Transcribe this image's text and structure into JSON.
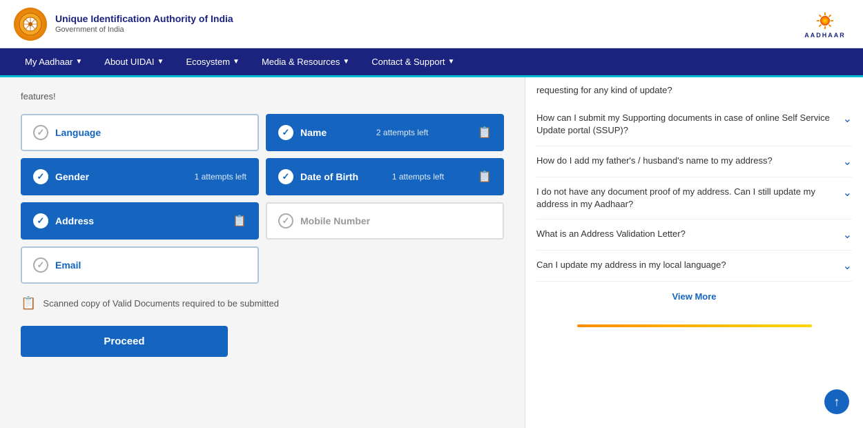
{
  "header": {
    "org_name": "Unique Identification Authority of India",
    "gov_name": "Government of India",
    "logo_text": "AADHAAR"
  },
  "navbar": {
    "items": [
      {
        "label": "My Aadhaar",
        "has_arrow": true
      },
      {
        "label": "About UIDAI",
        "has_arrow": true
      },
      {
        "label": "Ecosystem",
        "has_arrow": true
      },
      {
        "label": "Media & Resources",
        "has_arrow": true
      },
      {
        "label": "Contact & Support",
        "has_arrow": true
      }
    ]
  },
  "left_panel": {
    "features_text": "features!",
    "update_options": [
      {
        "id": "language",
        "label": "Language",
        "status": "inactive",
        "attempts": null,
        "has_doc_icon": false
      },
      {
        "id": "name",
        "label": "Name",
        "status": "active",
        "attempts": "2 attempts left",
        "has_doc_icon": true
      },
      {
        "id": "gender",
        "label": "Gender",
        "status": "active",
        "attempts": "1 attempts left",
        "has_doc_icon": false
      },
      {
        "id": "dob",
        "label": "Date of Birth",
        "status": "active",
        "attempts": "1 attempts left",
        "has_doc_icon": true
      },
      {
        "id": "address",
        "label": "Address",
        "status": "active",
        "attempts": null,
        "has_doc_icon": true
      },
      {
        "id": "mobile",
        "label": "Mobile Number",
        "status": "disabled",
        "attempts": null,
        "has_doc_icon": false
      },
      {
        "id": "email",
        "label": "Email",
        "status": "inactive",
        "attempts": null,
        "has_doc_icon": false
      }
    ],
    "doc_note": "Scanned copy of Valid Documents required to be submitted",
    "proceed_label": "Proceed"
  },
  "right_panel": {
    "partial_text": "requesting for any kind of update?",
    "faqs": [
      {
        "id": "faq1",
        "question": "How can I submit my Supporting documents in case of online Self Service Update portal (SSUP)?"
      },
      {
        "id": "faq2",
        "question": "How do I add my father's / husband's name to my address?"
      },
      {
        "id": "faq3",
        "question": "I do not have any document proof of my address. Can I still update my address in my Aadhaar?"
      },
      {
        "id": "faq4",
        "question": "What is an Address Validation Letter?"
      },
      {
        "id": "faq5",
        "question": "Can I update my address in my local language?"
      }
    ],
    "view_more_label": "View More"
  },
  "scroll_up": "↑"
}
